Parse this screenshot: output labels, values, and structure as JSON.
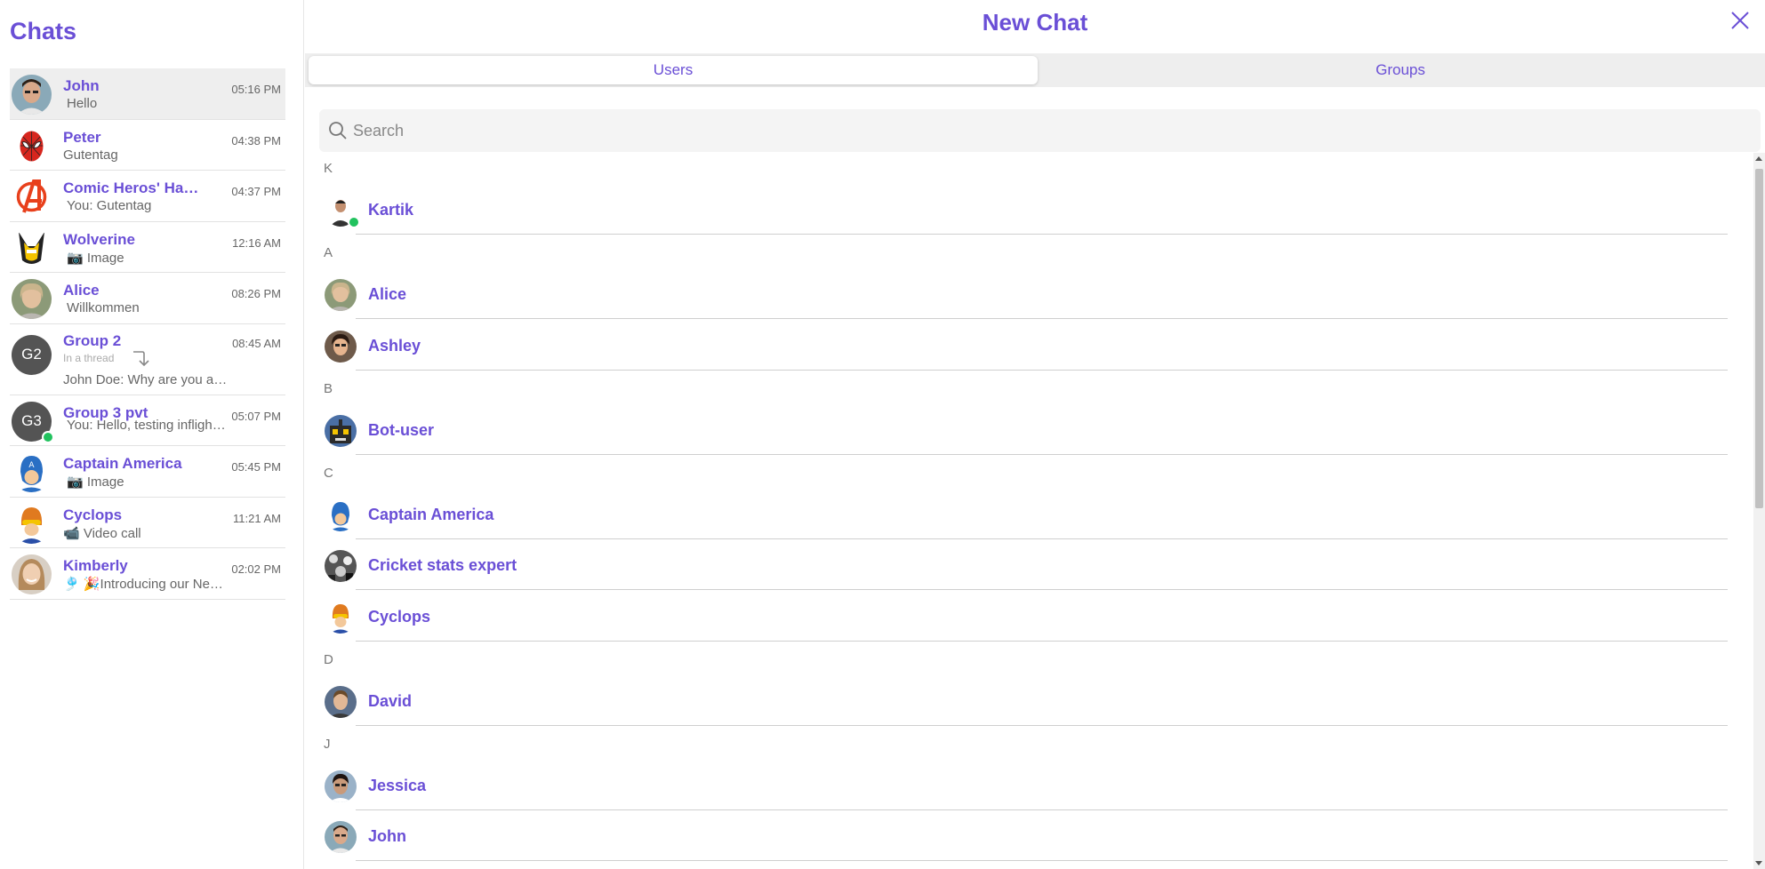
{
  "sidebar": {
    "title": "Chats",
    "chats": [
      {
        "name": "John",
        "time": "05:16 PM",
        "preview": "Hello",
        "avatar": "john-avatar"
      },
      {
        "name": "Peter",
        "time": "04:38 PM",
        "preview": "Gutentag",
        "avatar": "spiderman-avatar"
      },
      {
        "name": "Comic Heros' Ha…",
        "time": "04:37 PM",
        "preview": "You: Gutentag",
        "avatar": "avengers-avatar"
      },
      {
        "name": "Wolverine",
        "time": "12:16 AM",
        "preview": "📷 Image",
        "avatar": "wolverine-avatar"
      },
      {
        "name": "Alice",
        "time": "08:26 PM",
        "preview": "Willkommen",
        "avatar": "alice-avatar"
      },
      {
        "name": "Group 2",
        "time": "08:45 AM",
        "thread_label": "In a thread",
        "preview": "John Doe: Why are you a…",
        "initials": "G2"
      },
      {
        "name": "Group 3 pvt",
        "time": "05:07 PM",
        "preview": "You: Hello, testing infligh…",
        "initials": "G3"
      },
      {
        "name": "Captain America",
        "time": "05:45 PM",
        "preview": "📷 Image",
        "avatar": "captain-america-avatar"
      },
      {
        "name": "Cyclops",
        "time": "11:21 AM",
        "preview": "📹 Video call",
        "avatar": "cyclops-avatar"
      },
      {
        "name": "Kimberly",
        "time": "02:02 PM",
        "preview": "🎐 🎉Introducing our Ne…",
        "avatar": "kimberly-avatar"
      }
    ]
  },
  "main": {
    "title": "New Chat",
    "tabs": {
      "users": "Users",
      "groups": "Groups"
    },
    "search_placeholder": "Search",
    "sections": [
      {
        "letter": "K",
        "users": [
          "Kartik"
        ]
      },
      {
        "letter": "A",
        "users": [
          "Alice",
          "Ashley"
        ]
      },
      {
        "letter": "B",
        "users": [
          "Bot-user"
        ]
      },
      {
        "letter": "C",
        "users": [
          "Captain America",
          "Cricket stats expert",
          "Cyclops"
        ]
      },
      {
        "letter": "D",
        "users": [
          "David"
        ]
      },
      {
        "letter": "J",
        "users": [
          "Jessica",
          "John"
        ]
      }
    ]
  },
  "colors": {
    "accent": "#6a4fd6",
    "online": "#21c25e"
  }
}
